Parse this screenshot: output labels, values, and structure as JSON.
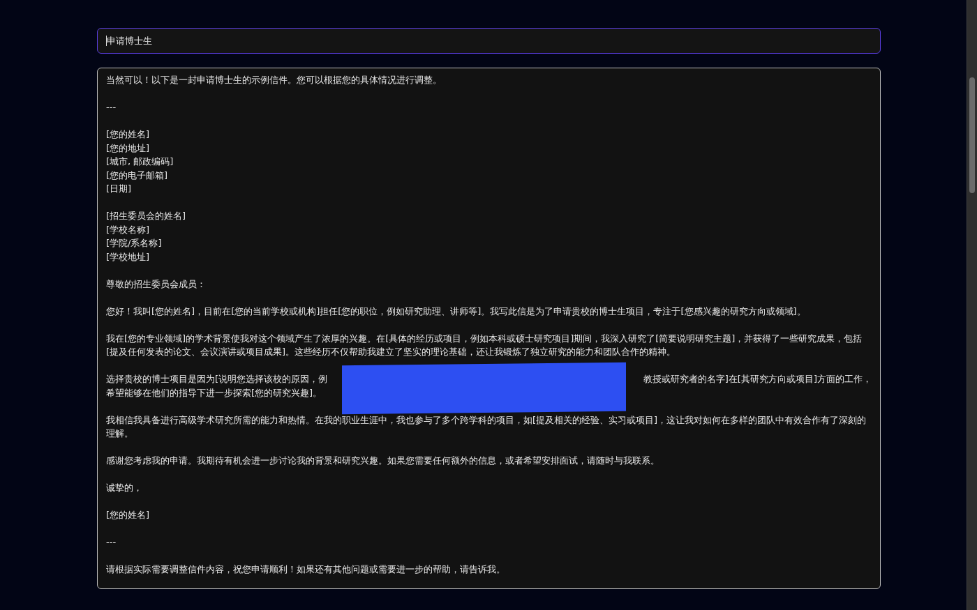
{
  "prompt_field": {
    "value": "申请博士生",
    "focused": true
  },
  "response": {
    "paragraphs": [
      {
        "kind": "text",
        "lines": [
          "当然可以！以下是一封申请博士生的示例信件。您可以根据您的具体情况进行调整。"
        ]
      },
      {
        "kind": "text",
        "lines": [
          "---"
        ]
      },
      {
        "kind": "text",
        "lines": [
          "[您的姓名]",
          "[您的地址]",
          "[城市, 邮政编码]",
          "[您的电子邮箱]",
          "[日期]"
        ]
      },
      {
        "kind": "text",
        "lines": [
          "[招生委员会的姓名]",
          "[学校名称]",
          "[学院/系名称]",
          "[学校地址]"
        ]
      },
      {
        "kind": "text",
        "lines": [
          "尊敬的招生委员会成员："
        ]
      },
      {
        "kind": "text",
        "lines": [
          "您好！我叫[您的姓名]，目前在[您的当前学校或机构]担任[您的职位，例如研究助理、讲师等]。我写此信是为了申请贵校的博士生项目，专注于[您感兴趣的研究方向或领域]。"
        ]
      },
      {
        "kind": "text",
        "lines": [
          "我在[您的专业领域]的学术背景使我对这个领域产生了浓厚的兴趣。在[具体的经历或项目，例如本科或硕士研究项目]期间，我深入研究了[简要说明研究主题]，并获得了一些研究成果，包括[提及任何发表的论文、会议演讲或项目成果]。这些经历不仅帮助我建立了坚实的理论基础，还让我锻炼了独立研究的能力和团队合作的精神。"
        ]
      },
      {
        "kind": "redacted",
        "before": "选择贵校的博士项目是因为[说明您选择该校的原因，例",
        "after": "教授或研究者的名字]在[其研究方向或项目]方面的工作，",
        "next_line": "希望能够在他们的指导下进一步探索[您的研究兴趣]。"
      },
      {
        "kind": "text",
        "lines": [
          "我相信我具备进行高级学术研究所需的能力和热情。在我的职业生涯中，我也参与了多个跨学科的项目，如[提及相关的经验、实习或项目]，这让我对如何在多样的团队中有效合作有了深刻的理解。"
        ]
      },
      {
        "kind": "text",
        "lines": [
          "感谢您考虑我的申请。我期待有机会进一步讨论我的背景和研究兴趣。如果您需要任何额外的信息，或者希望安排面试，请随时与我联系。"
        ]
      },
      {
        "kind": "text",
        "lines": [
          "诚挚的，"
        ]
      },
      {
        "kind": "text",
        "lines": [
          "[您的姓名]"
        ]
      },
      {
        "kind": "text",
        "lines": [
          "---"
        ]
      },
      {
        "kind": "text",
        "lines": [
          "请根据实际需要调整信件内容，祝您申请顺利！如果还有其他问题或需要进一步的帮助，请告诉我。"
        ]
      }
    ]
  }
}
